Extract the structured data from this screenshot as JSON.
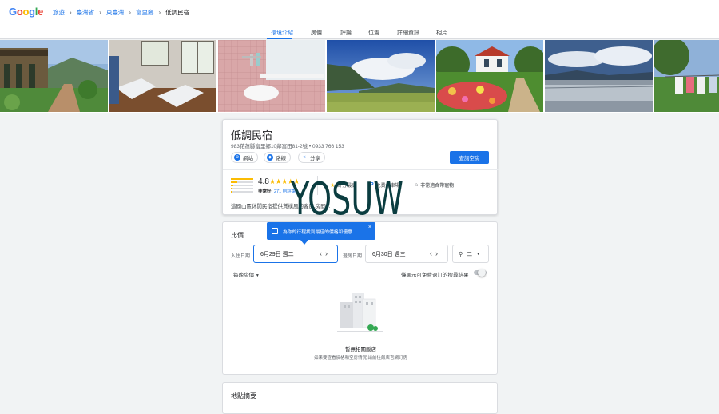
{
  "header": {
    "logo": "Google",
    "breadcrumbs": [
      "旅遊",
      "臺灣省",
      "東臺灣",
      "富里鄉",
      "低調民宿"
    ]
  },
  "tabs": [
    "環境介紹",
    "房價",
    "評論",
    "位置",
    "詳細資訊",
    "相片"
  ],
  "hotel": {
    "name": "低調民宿",
    "address": "983花蓮縣富里鄉10鄰富田81-2號 • 0933 766 153",
    "actions": [
      "網站",
      "路線",
      "分享"
    ],
    "check_button": "查詢空房",
    "rating": "4.8",
    "stars": "★★★★★",
    "rating_word": "非常好",
    "reviews": "271 則評論",
    "amenities": [
      "評分最高",
      "免費停車場",
      "非常適合帶寵物"
    ],
    "description": "這間山區休閒民宿提供質樸風的客房,房間..."
  },
  "watermark": "YOSUW",
  "pricing": {
    "title": "比價",
    "tooltip": "為你的行程找到最佳的價格和優惠",
    "tooltip_close": "×",
    "checkin_label": "入住日期",
    "checkin_value": "6月29日 週二",
    "checkout_label": "退房日期",
    "checkout_value": "6月30日 週三",
    "guests_value": "二",
    "nightly_label": "每晚房價",
    "free_cancel_label": "僅顯示可免費退訂的搜尋結果",
    "empty_title": "暫無相關飯店",
    "empty_sub": "如果要查看價格和空房情況,請前往飯店官網訂房"
  },
  "map_section": {
    "title": "地點摘要"
  },
  "colors": {
    "accent": "#1a73e8",
    "star": "#fbbc04",
    "watermark": "#0b3d40"
  }
}
